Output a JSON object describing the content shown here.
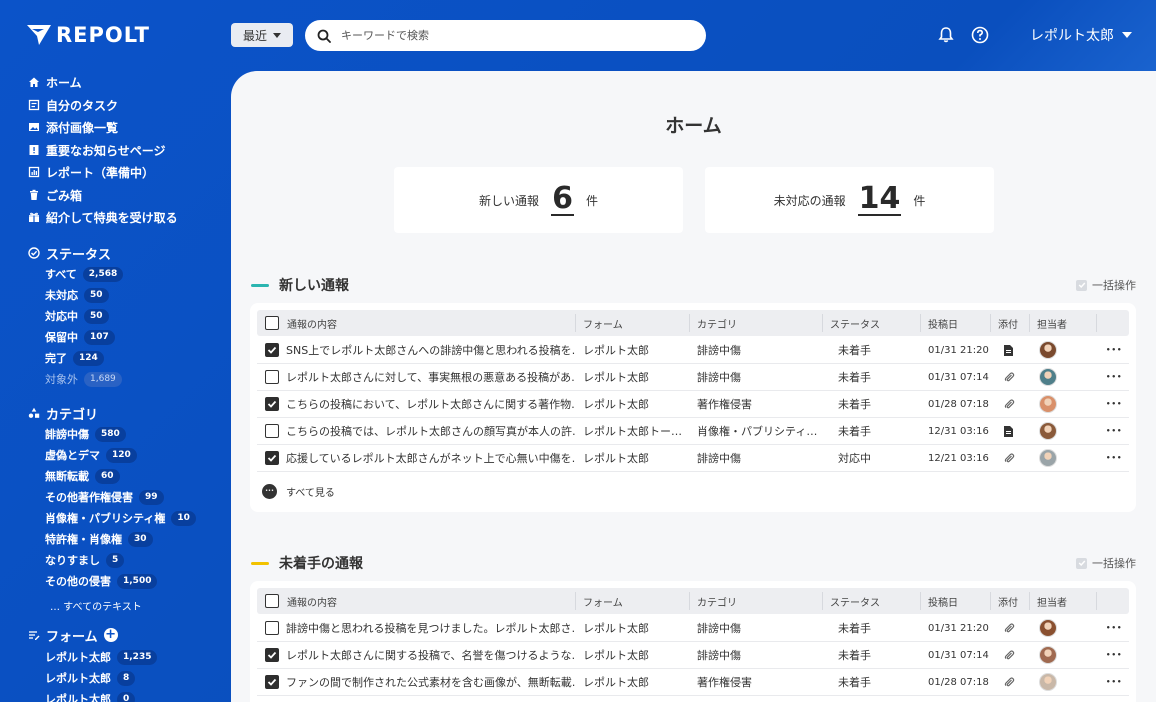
{
  "header": {
    "logo_text": "REPOLT",
    "recent_label": "最近",
    "search_placeholder": "キーワードで検索",
    "user_name": "レポルト太郎"
  },
  "sidebar": {
    "nav": [
      {
        "label": "ホーム",
        "icon": "home-icon"
      },
      {
        "label": "自分のタスク",
        "icon": "task-icon"
      },
      {
        "label": "添付画像一覧",
        "icon": "image-icon"
      },
      {
        "label": "重要なお知らせページ",
        "icon": "notice-icon"
      },
      {
        "label": "レポート（準備中）",
        "icon": "report-icon"
      },
      {
        "label": "ごみ箱",
        "icon": "trash-icon"
      },
      {
        "label": "紹介して特典を受け取る",
        "icon": "gift-icon"
      }
    ],
    "status": {
      "title": "ステータス",
      "items": [
        {
          "label": "すべて",
          "count": "2,568"
        },
        {
          "label": "未対応",
          "count": "50"
        },
        {
          "label": "対応中",
          "count": "50"
        },
        {
          "label": "保留中",
          "count": "107"
        },
        {
          "label": "完了",
          "count": "124"
        },
        {
          "label": "対象外",
          "count": "1,689"
        }
      ]
    },
    "category": {
      "title": "カテゴリ",
      "items": [
        {
          "label": "誹謗中傷",
          "count": "580"
        },
        {
          "label": "虚偽とデマ",
          "count": "120"
        },
        {
          "label": "無断転載",
          "count": "60"
        },
        {
          "label": "その他著作権侵害",
          "count": "99"
        },
        {
          "label": "肖像権・パブリシティ権",
          "count": "10"
        },
        {
          "label": "特許権・肖像権",
          "count": "30"
        },
        {
          "label": "なりすまし",
          "count": "5"
        },
        {
          "label": "その他の侵害",
          "count": "1,500"
        }
      ],
      "more_label": "… すべてのテキスト"
    },
    "form": {
      "title": "フォーム",
      "items": [
        {
          "label": "レポルト太郎",
          "count": "1,235"
        },
        {
          "label": "レポルト太郎",
          "count": "8"
        },
        {
          "label": "レポルト太郎",
          "count": "0"
        }
      ]
    }
  },
  "main": {
    "title": "ホーム",
    "stats": [
      {
        "label": "新しい通報",
        "value": "6",
        "unit": "件"
      },
      {
        "label": "未対応の通報",
        "value": "14",
        "unit": "件"
      }
    ],
    "columns": [
      "通報の内容",
      "フォーム",
      "カテゴリ",
      "ステータス",
      "投稿日",
      "添付",
      "担当者"
    ],
    "new_reports": {
      "title": "新しい通報",
      "accent": "#2bb5b0",
      "bulk_label": "一括操作",
      "see_all": "すべて見る",
      "rows": [
        {
          "checked": true,
          "content": "SNS上でレポルト太郎さんへの誹謗中傷と思われる投稿を…",
          "form": "レポルト太郎",
          "category": "誹謗中傷",
          "status": "未着手",
          "date": "01/31 21:20",
          "attach": "file-icon",
          "avatar": "#7a4a2e"
        },
        {
          "checked": false,
          "content": "レポルト太郎さんに対して、事実無根の悪意ある投稿があ…",
          "form": "レポルト太郎",
          "category": "誹謗中傷",
          "status": "未着手",
          "date": "01/31 07:14",
          "attach": "paperclip-icon",
          "avatar": "#4f7f8a"
        },
        {
          "checked": true,
          "content": "こちらの投稿において、レポルト太郎さんに関する著作物…",
          "form": "レポルト太郎",
          "category": "著作権侵害",
          "status": "未着手",
          "date": "01/28 07:18",
          "attach": "paperclip-icon",
          "avatar": "#d9906a"
        },
        {
          "checked": false,
          "content": "こちらの投稿では、レポルト太郎さんの顔写真が本人の許…",
          "form": "レポルト太郎トー…",
          "category": "肖像権・パブリシティ…",
          "status": "未着手",
          "date": "12/31 03:16",
          "attach": "file-icon",
          "avatar": "#8a5a3a"
        },
        {
          "checked": true,
          "content": "応援しているレポルト太郎さんがネット上で心無い中傷を…",
          "form": "レポルト太郎",
          "category": "誹謗中傷",
          "status": "対応中",
          "date": "12/21 03:16",
          "attach": "paperclip-icon",
          "avatar": "#9aa4a8"
        }
      ]
    },
    "pending_reports": {
      "title": "未着手の通報",
      "accent": "#f2c200",
      "bulk_label": "一括操作",
      "rows": [
        {
          "checked": false,
          "content": "誹謗中傷と思われる投稿を見つけました。レポルト太郎さ…",
          "form": "レポルト太郎",
          "category": "誹謗中傷",
          "status": "未着手",
          "date": "01/31 21:20",
          "attach": "paperclip-icon",
          "avatar": "#8a5030"
        },
        {
          "checked": true,
          "content": "レポルト太郎さんに関する投稿で、名誉を傷つけるような…",
          "form": "レポルト太郎",
          "category": "誹謗中傷",
          "status": "未着手",
          "date": "01/31 07:14",
          "attach": "paperclip-icon",
          "avatar": "#a06a50"
        },
        {
          "checked": true,
          "content": "ファンの間で制作された公式素材を含む画像が、無断転載…",
          "form": "レポルト太郎",
          "category": "著作権侵害",
          "status": "未着手",
          "date": "01/28 07:18",
          "attach": "paperclip-icon",
          "avatar": "#c9b8a8"
        }
      ]
    }
  }
}
